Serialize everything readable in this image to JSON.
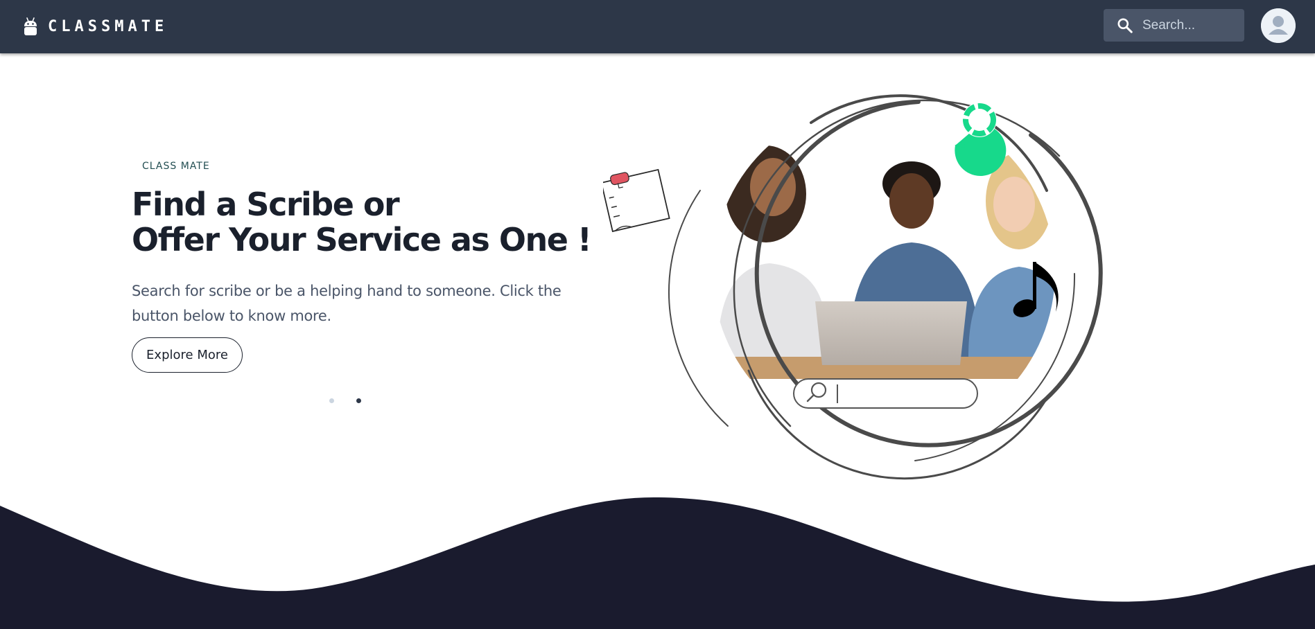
{
  "navbar": {
    "brand": "CLASSMATE",
    "brand_icon": "android-icon",
    "search_placeholder": "Search...",
    "search_icon": "search-icon",
    "avatar_icon": "user-avatar-icon",
    "background": "#2d3748"
  },
  "hero": {
    "eyebrow": "CLASS MATE",
    "headline_line1": "Find a Scribe or",
    "headline_line2": "Offer Your Service as One !",
    "lead": "Search for scribe or be a helping hand to someone. Click the button below to know more.",
    "cta_label": "Explore More",
    "carousel": {
      "total_slides": 2,
      "active_slide": 2
    }
  },
  "illustration": {
    "icons": [
      "sticky-note-icon",
      "chat-bubble-icon",
      "music-note-icon",
      "search-bar-icon",
      "magnifier-icon"
    ],
    "photo": "three-students-laptop-photo",
    "accent_green": "#17d98b",
    "sticky_pin_color": "#e05561"
  },
  "footer_wave_color": "#1a1b2e"
}
